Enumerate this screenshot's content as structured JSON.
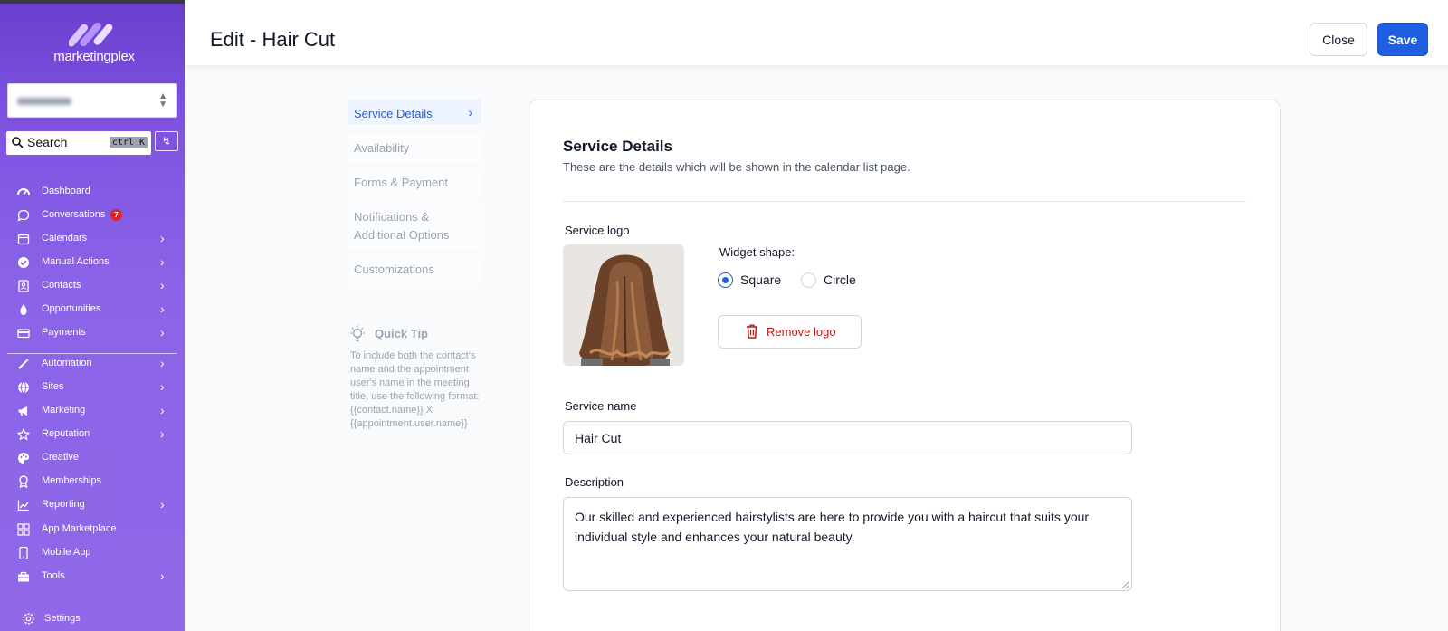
{
  "sidebar": {
    "brand": "marketingplex",
    "account_selector": "Demo - All",
    "search": {
      "label": "Search",
      "shortcut": "ctrl K"
    },
    "items": [
      {
        "label": "Dashboard",
        "icon": "dashboard-icon"
      },
      {
        "label": "Conversations",
        "icon": "chat-icon",
        "badge": "7"
      },
      {
        "label": "Calendars",
        "icon": "calendar-icon"
      },
      {
        "label": "Manual Actions",
        "icon": "check-circle-icon"
      },
      {
        "label": "Contacts",
        "icon": "contacts-icon"
      },
      {
        "label": "Opportunities",
        "icon": "funnel-icon"
      },
      {
        "label": "Payments",
        "icon": "credit-card-icon"
      },
      {
        "label": "Automation",
        "icon": "wand-icon"
      },
      {
        "label": "Sites",
        "icon": "globe-icon"
      },
      {
        "label": "Marketing",
        "icon": "megaphone-icon"
      },
      {
        "label": "Reputation",
        "icon": "star-icon"
      },
      {
        "label": "Creative",
        "icon": "palette-icon"
      },
      {
        "label": "Memberships",
        "icon": "award-icon"
      },
      {
        "label": "Reporting",
        "icon": "chart-icon"
      },
      {
        "label": "App Marketplace",
        "icon": "grid-icon"
      },
      {
        "label": "Mobile App",
        "icon": "phone-icon"
      },
      {
        "label": "Tools",
        "icon": "toolbox-icon"
      }
    ],
    "settings": "Settings"
  },
  "header": {
    "title": "Edit - Hair Cut",
    "close_label": "Close",
    "save_label": "Save"
  },
  "subnav": {
    "items": [
      "Service Details",
      "Availability",
      "Forms & Payment",
      "Notifications & Additional Options",
      "Customizations"
    ],
    "active": "Service Details"
  },
  "tip": {
    "title": "Quick Tip",
    "body": "To include both the contact's name and the appointment user's name in the meeting title, use the following format: {{contact.name}} X {{appointment.user.name}}"
  },
  "form": {
    "heading": "Service Details",
    "subheading": "These are the details which will be shown in the calendar list page.",
    "logo_label": "Service logo",
    "widget_shape_label": "Widget shape:",
    "shape_options": [
      "Square",
      "Circle"
    ],
    "shape_selected": "Square",
    "remove_logo_label": "Remove logo",
    "name_label": "Service name",
    "name_value": "Hair Cut",
    "description_label": "Description",
    "description_value": "Our skilled and experienced hairstylists are here to provide you with a haircut that suits your individual style and enhances your natural beauty."
  },
  "colors": {
    "primary": "#1d5fe0",
    "sidebar": "#8b63e8",
    "danger": "#b91c1c",
    "badge": "#dc2626"
  }
}
